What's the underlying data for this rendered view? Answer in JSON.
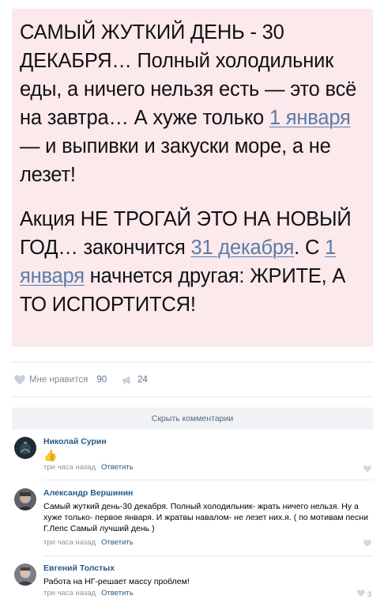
{
  "post": {
    "meme": {
      "p1": {
        "t1": "САМЫЙ ЖУТКИЙ ДЕНЬ - 30 ДЕКАБРЯ… Полный холодильник еды, а ничего нельзя есть — это всё на завтра… А хуже только ",
        "link1": "1 января",
        "t2": " — и выпивки и закуски море, а не лезет!"
      },
      "p2": {
        "t1": "Акция НЕ ТРОГАЙ ЭТО НА НОВЫЙ ГОД… закончится ",
        "link1": "31 декабря",
        "t2": ". С ",
        "link2": "1 января",
        "t3": " начнется другая: ЖРИТЕ, А ТО ИСПОРТИТСЯ!"
      }
    },
    "actions": {
      "like_label": "Мне нравится",
      "like_count": "90",
      "share_count": "24"
    },
    "hide_comments_label": "Скрыть комментарии"
  },
  "colors": {
    "link": "#2a5885",
    "meme_bg": "#fbe9ec",
    "meta": "#939393"
  },
  "comments": [
    {
      "author": "Николай Сурин",
      "text": "",
      "emoji": "👍",
      "time": "три часа назад",
      "reply_label": "Ответить",
      "likes": ""
    },
    {
      "author": "Александр Вершинин",
      "text": "Самый жуткий день-30 декабря. Полный холодильник- жрать ничего нельзя. Ну а хуже только- первое января. И жратвы навалом- не лезет них.я. ( по мотивам песни Г.Лепс Самый лучший день )",
      "time": "три часа назад",
      "reply_label": "Ответить",
      "likes": ""
    },
    {
      "author": "Евгений Толстых",
      "text": "Работа на НГ-решает массу проблем!",
      "time": "три часа назад",
      "reply_label": "Ответить",
      "likes": "3"
    }
  ]
}
